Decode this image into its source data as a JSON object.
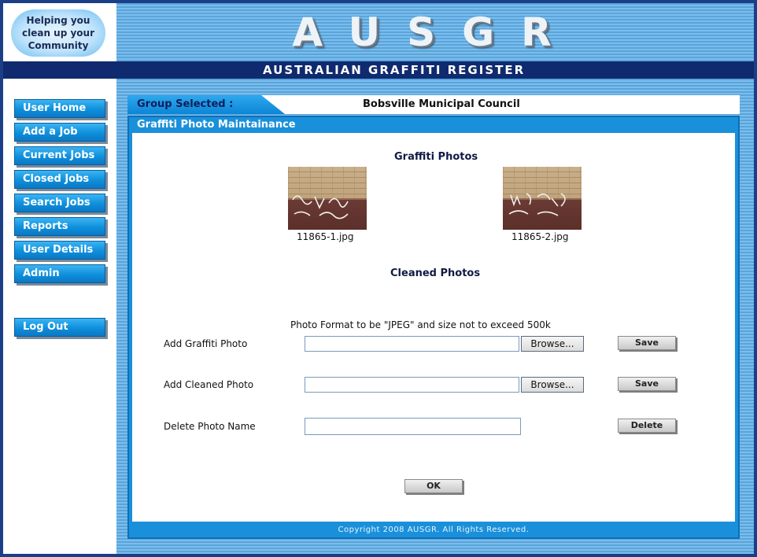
{
  "logo": {
    "text": "Helping you\nclean up your\nCommunity"
  },
  "header": {
    "title": "AUSGR",
    "subtitle": "AUSTRALIAN GRAFFITI REGISTER"
  },
  "nav": {
    "items": [
      {
        "label": "User Home"
      },
      {
        "label": "Add a Job"
      },
      {
        "label": "Current Jobs"
      },
      {
        "label": "Closed Jobs"
      },
      {
        "label": "Search Jobs"
      },
      {
        "label": "Reports"
      },
      {
        "label": "User Details"
      },
      {
        "label": "Admin"
      }
    ],
    "logout": "Log Out"
  },
  "group": {
    "label": "Group Selected :",
    "value": "Bobsville Municipal Council"
  },
  "panel": {
    "title": "Graffiti Photo Maintainance",
    "graffiti_heading": "Graffiti Photos",
    "photos": [
      {
        "name": "11865-1.jpg"
      },
      {
        "name": "11865-2.jpg"
      }
    ],
    "cleaned_heading": "Cleaned Photos",
    "format_note": "Photo Format to be \"JPEG\" and size not to exceed 500k",
    "add_graffiti_label": "Add Graffiti Photo",
    "add_cleaned_label": "Add Cleaned Photo",
    "delete_label": "Delete Photo Name",
    "browse_label": "Browse...",
    "save_label": "Save",
    "delete_button": "Delete",
    "ok_button": "OK",
    "copyright": "Copyright 2008 AUSGR. All Rights Reserved."
  },
  "colors": {
    "nav_button": "#0e8fdc",
    "header_bar": "#0f2a6e",
    "panel": "#1a90da"
  }
}
